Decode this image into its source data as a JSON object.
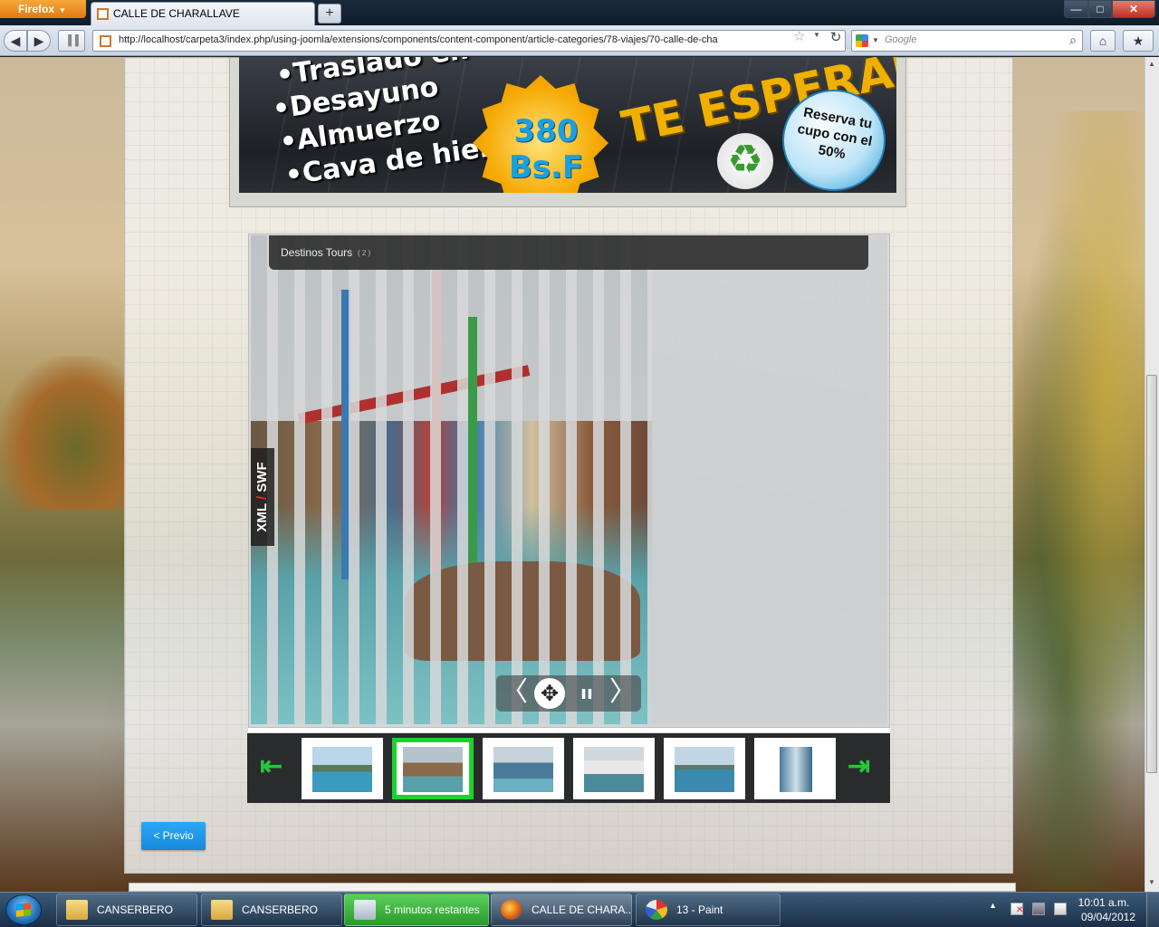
{
  "browser": {
    "menu_label": "Firefox",
    "menu_arrow": "▼",
    "tab_title": "CALLE DE CHARALLAVE",
    "new_tab": "+",
    "url": "http://localhost/carpeta3/index.php/using-joomla/extensions/components/content-component/article-categories/78-viajes/70-calle-de-cha",
    "search_placeholder": "Google",
    "window_controls": {
      "minimize": "—",
      "maximize": "□",
      "close": "✕"
    },
    "nav_glyphs": {
      "back": "◀",
      "forward": "▶",
      "bars": "▐▐",
      "star": "☆",
      "dropdown": "▼",
      "reload": "↻",
      "search": "⌕",
      "home": "⌂",
      "bookmarks": "★"
    }
  },
  "banner": {
    "items": [
      "•Traslado en",
      "•Desayuno",
      "•Almuerzo",
      "•Cava de hielo"
    ],
    "price": "380 Bs.F",
    "headline": "TE ESPERAN",
    "reserve_text": "Reserva tu cupo con el 50%",
    "recycle_glyph": "♻"
  },
  "slideshow": {
    "title": "Destinos Tours",
    "count": "( 2 )",
    "format_left": "XML",
    "format_sep": "/",
    "format_right": "SWF",
    "controls": {
      "prev": "〈",
      "move": "✥",
      "pause": "ıı",
      "next": "〉"
    },
    "thumb_prev": "⇤",
    "thumb_next": "⇥",
    "thumbnails_count": 6,
    "active_thumbnail": 2
  },
  "page": {
    "prev_button": "< Previo"
  },
  "scrollbar": {
    "up": "▲",
    "down": "▼"
  },
  "taskbar": {
    "tasks": [
      {
        "label": "CANSERBERO"
      },
      {
        "label": "CANSERBERO"
      },
      {
        "label": "5 minutos restantes"
      },
      {
        "label": "CALLE DE CHARA..."
      },
      {
        "label": "13 - Paint"
      }
    ],
    "tray_up": "▲",
    "time": "10:01 a.m.",
    "date": "09/04/2012"
  }
}
